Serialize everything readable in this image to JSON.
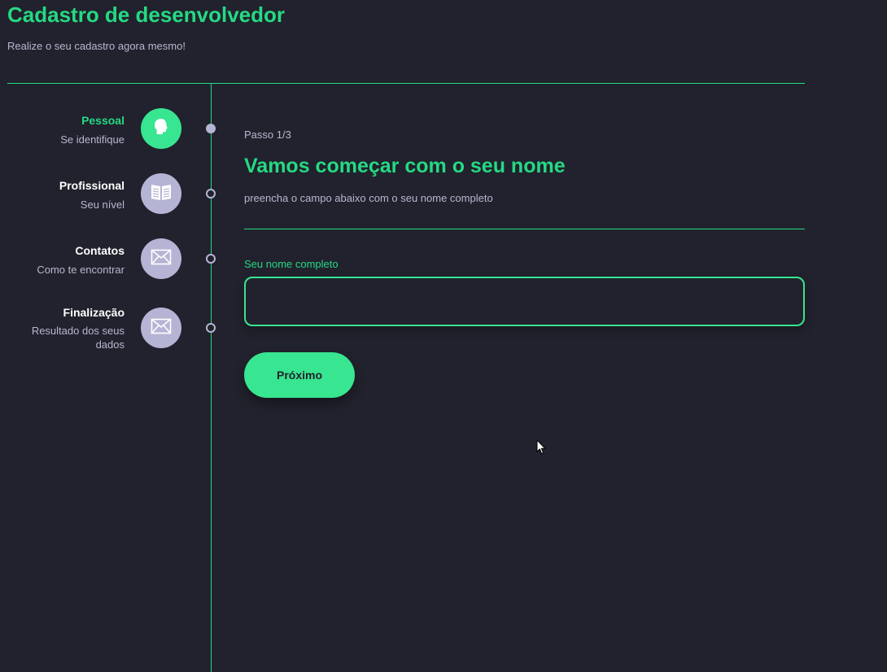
{
  "header": {
    "title": "Cadastro de desenvolvedor",
    "subtitle": "Realize o seu cadastro agora mesmo!"
  },
  "steps": [
    {
      "title": "Pessoal",
      "description": "Se identifique",
      "icon": "head-icon",
      "active": true
    },
    {
      "title": "Profissional",
      "description": "Seu nível",
      "icon": "book-icon",
      "active": false
    },
    {
      "title": "Contatos",
      "description": "Como te encontrar",
      "icon": "mail-icon",
      "active": false
    },
    {
      "title": "Finalização",
      "description": "Resultado dos seus dados",
      "icon": "mail-icon",
      "active": false
    }
  ],
  "main": {
    "step_indicator": "Passo 1/3",
    "heading": "Vamos começar com o seu nome",
    "description": "preencha o campo abaixo com o seu nome completo",
    "field_label": "Seu nome completo",
    "field_value": "",
    "next_label": "Próximo"
  },
  "colors": {
    "background": "#21222d",
    "accent": "#25d983",
    "accent_button": "#38e590",
    "muted": "#b6b4d4",
    "text_muted": "#b8b6d0"
  }
}
